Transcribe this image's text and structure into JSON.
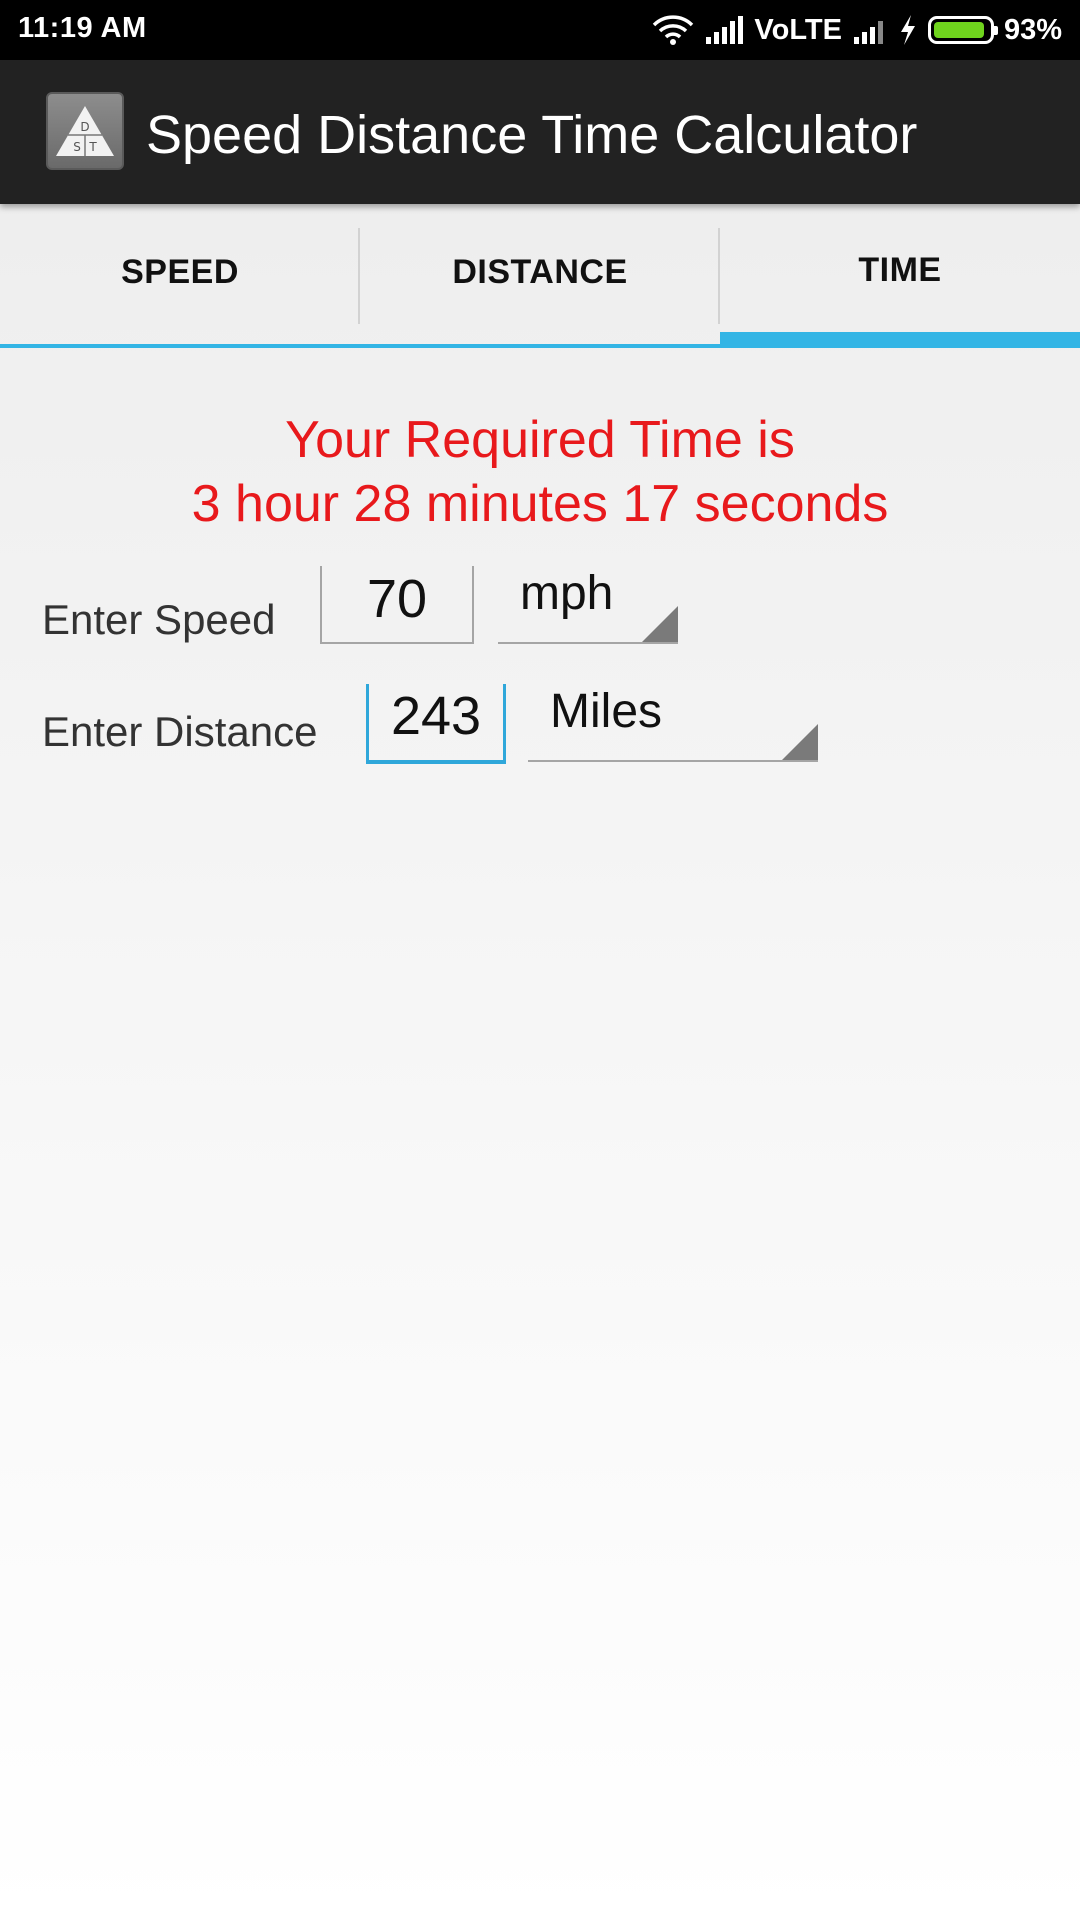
{
  "status_bar": {
    "time": "11:19 AM",
    "network_label": "VoLTE",
    "battery_percent_text": "93%",
    "battery_level": 0.93,
    "battery_color": "#6fd41d",
    "icons": [
      "wifi-icon",
      "signal-icon",
      "signal-icon",
      "charging-bolt-icon",
      "battery-icon"
    ]
  },
  "action_bar": {
    "title": "Speed Distance Time Calculator",
    "icon_letters": [
      "D",
      "S",
      "T"
    ]
  },
  "tabs": [
    {
      "label": "SPEED",
      "active": false
    },
    {
      "label": "DISTANCE",
      "active": false
    },
    {
      "label": "TIME",
      "active": true
    }
  ],
  "accent_color": "#33b5e5",
  "result": {
    "line1": "Your Required Time is",
    "line2": "3 hour 28 minutes 17 seconds",
    "color": "#e8191c"
  },
  "form": {
    "speed": {
      "label": "Enter Speed",
      "value": "70",
      "unit": "mph"
    },
    "distance": {
      "label": "Enter Distance",
      "value": "243",
      "unit": "Miles"
    }
  }
}
